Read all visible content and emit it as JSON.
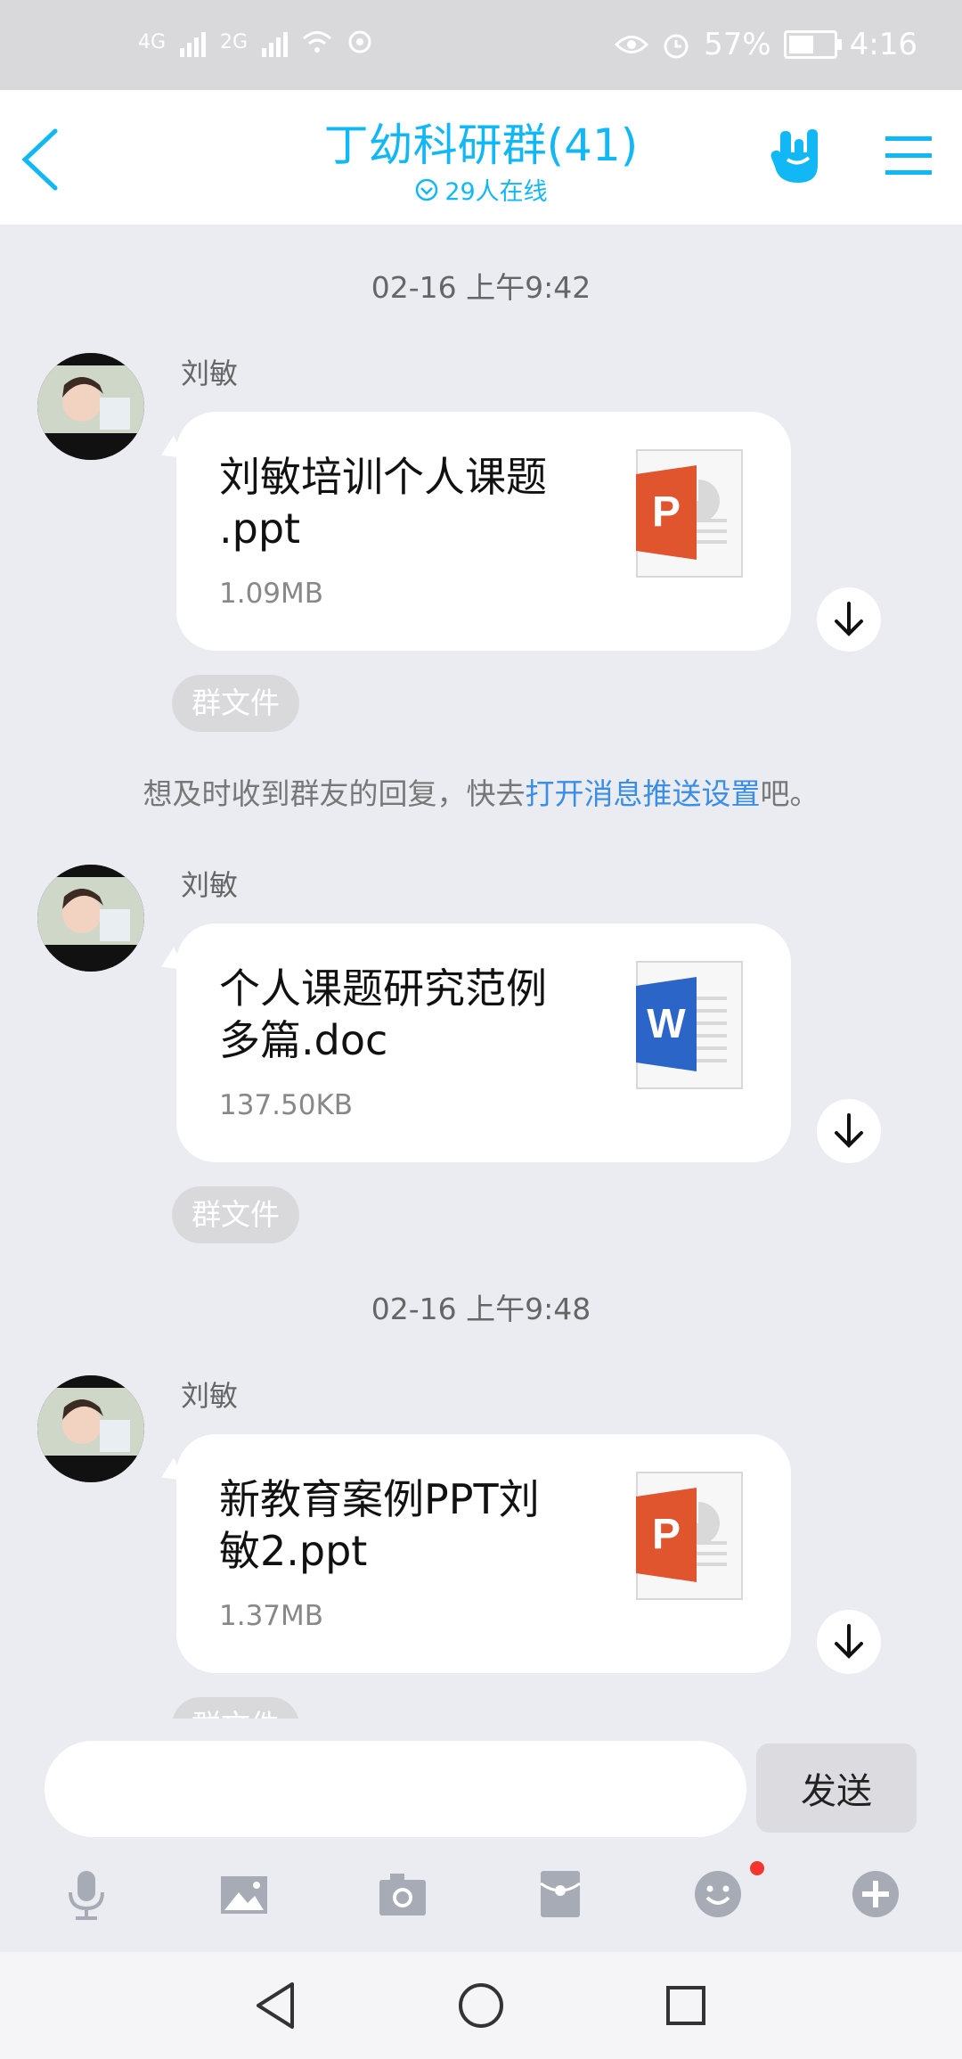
{
  "statusbar": {
    "net1": "4G",
    "net2": "2G",
    "battery_text": "57%",
    "battery_level": 0.57,
    "time": "4:16"
  },
  "header": {
    "title": "丁幼科研群(41)",
    "online": "29人在线"
  },
  "messages": [
    {
      "time": "02-16 上午9:42",
      "sender": "刘敏",
      "file_name": [
        "刘敏培训个人课题",
        ".ppt"
      ],
      "file_size": "1.09MB",
      "file_type": "ppt",
      "tag": "群文件"
    },
    {
      "sender": "刘敏",
      "file_name": [
        "个人课题研究范例",
        "多篇.doc"
      ],
      "file_size": "137.50KB",
      "file_type": "doc",
      "tag": "群文件"
    },
    {
      "time": "02-16 上午9:48",
      "sender": "刘敏",
      "file_name": [
        "新教育案例PPT刘",
        "敏2.ppt"
      ],
      "file_size": "1.37MB",
      "file_type": "ppt",
      "tag": "群文件"
    }
  ],
  "notice": {
    "before": "想及时收到群友的回复，快去",
    "link": "打开消息推送设置",
    "after": "吧。"
  },
  "input": {
    "placeholder": "",
    "send_label": "发送"
  },
  "toolbar": [
    "microphone-icon",
    "image-icon",
    "camera-icon",
    "red-packet-icon",
    "emoji-icon",
    "plus-icon"
  ],
  "colors": {
    "accent": "#12b7f5",
    "ppt": "#e0552e",
    "doc": "#2b65c8",
    "link": "#3a8ee6",
    "badge": "#f43530"
  }
}
